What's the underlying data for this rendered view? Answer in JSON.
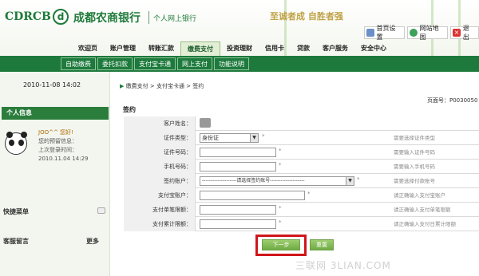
{
  "header": {
    "logo_en": "CDRCB",
    "logo_mark": "d",
    "logo_cn": "成都农商银行",
    "logo_sub": "个人网上银行",
    "slogan": "至诚者成 自胜者强",
    "tools": [
      {
        "label": "首页设置",
        "icon": "home-icon"
      },
      {
        "label": "网站地图",
        "icon": "map-icon"
      },
      {
        "label": "退出",
        "icon": "close-icon"
      }
    ]
  },
  "nav": {
    "items": [
      "欢迎页",
      "账户管理",
      "转账汇款",
      "缴费支付",
      "投资理财",
      "信用卡",
      "贷款",
      "客户服务",
      "安全中心"
    ],
    "active_index": 3
  },
  "subnav": {
    "items": [
      "自助缴费",
      "委托扣款",
      "支付宝卡通",
      "网上支付",
      "功能说明"
    ]
  },
  "sidebar": {
    "datetime": "2010-11-08  14:02",
    "personal_info_title": "个人信息",
    "greeting": "JOO^^ 您好!",
    "reserved_info_label": "您的预留信息：",
    "last_login_label": "上次登录时间：",
    "last_login_time": "2010.11.04 14:29",
    "quick_menu_title": "快捷菜单",
    "messages_title": "客服留言",
    "more_label": "更多"
  },
  "main": {
    "breadcrumb": "缴费支付 > 支付宝卡通 > 签约",
    "page_number": "页面号：P0030050",
    "section_title": "签约",
    "form": {
      "rows": [
        {
          "label": "客户姓名：",
          "hint": ""
        },
        {
          "label": "证件类型：",
          "value": "身份证",
          "hint": "需要选择证件类型"
        },
        {
          "label": "证件号码：",
          "value": "",
          "hint": "需要输入证件号码"
        },
        {
          "label": "手机号码：",
          "value": "",
          "hint": "需要输入手机号码"
        },
        {
          "label": "签约账户：",
          "value": "--------------------请选择签约账号--------------------",
          "hint": "需要选择付款账号"
        },
        {
          "label": "支付宝账户：",
          "value": "",
          "hint": "请正确输入支付宝账户"
        },
        {
          "label": "支付单笔限额：",
          "value": "",
          "hint": "请正确输入支付单笔限额"
        },
        {
          "label": "支付累计限额：",
          "value": "",
          "hint": "请正确输入支付日累计限额"
        }
      ],
      "star": "*"
    },
    "buttons": {
      "next": "下一步",
      "reset": "重置"
    }
  },
  "watermark": "三联网 3LIAN.COM",
  "colors": {
    "brand_green": "#1f7a3a",
    "subnav_bg": "#1d7a3c",
    "highlight_red": "#d0161c"
  }
}
